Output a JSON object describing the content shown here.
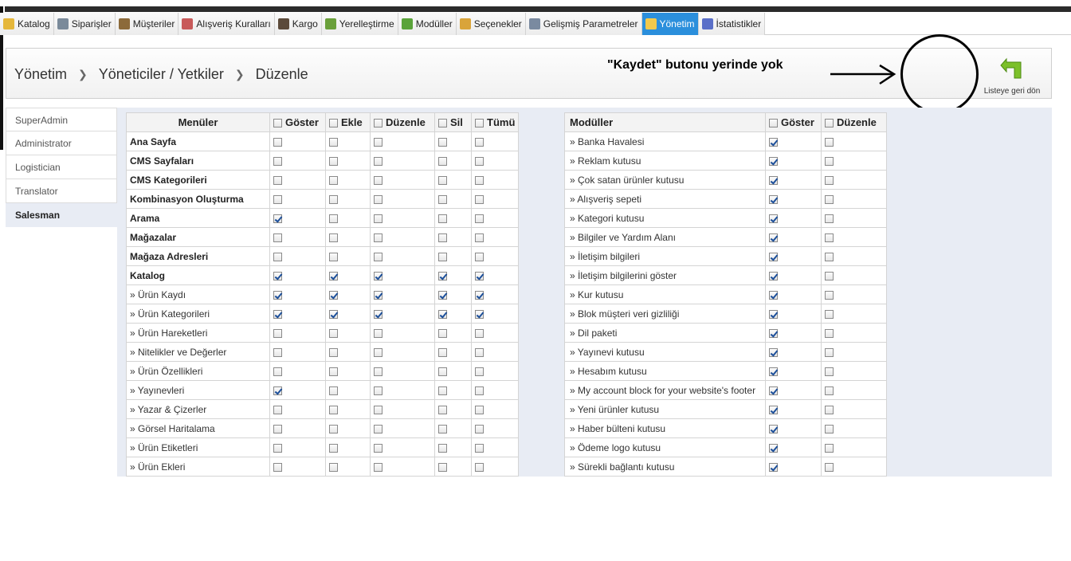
{
  "nav_tabs": [
    {
      "label": "Katalog",
      "icon": "folder-icon",
      "color": "#e5b73b"
    },
    {
      "label": "Siparişler",
      "icon": "cart-icon",
      "color": "#7a8a9a"
    },
    {
      "label": "Müşteriler",
      "icon": "user-icon",
      "color": "#8c6a3a"
    },
    {
      "label": "Alışveriş Kuralları",
      "icon": "rules-icon",
      "color": "#c85a5a"
    },
    {
      "label": "Kargo",
      "icon": "truck-icon",
      "color": "#5c4a3a"
    },
    {
      "label": "Yerelleştirme",
      "icon": "globe-icon",
      "color": "#6aa03a"
    },
    {
      "label": "Modüller",
      "icon": "puzzle-icon",
      "color": "#5aa33a"
    },
    {
      "label": "Seçenekler",
      "icon": "options-icon",
      "color": "#d9a43a"
    },
    {
      "label": "Gelişmiş Parametreler",
      "icon": "wrench-icon",
      "color": "#7a8aa0"
    },
    {
      "label": "Yönetim",
      "icon": "key-icon",
      "color": "#f2c94c",
      "active": true
    },
    {
      "label": "İstatistikler",
      "icon": "stats-icon",
      "color": "#5a6fc8"
    }
  ],
  "breadcrumb": [
    "Yönetim",
    "Yöneticiler / Yetkiler",
    "Düzenle"
  ],
  "annotation": "\"Kaydet\" butonu yerinde yok",
  "back_label": "Listeye geri dön",
  "profiles": [
    {
      "label": "SuperAdmin"
    },
    {
      "label": "Administrator"
    },
    {
      "label": "Logistician"
    },
    {
      "label": "Translator"
    },
    {
      "label": "Salesman",
      "active": true
    }
  ],
  "menus_table": {
    "headers": {
      "title": "Menüler",
      "show": "Göster",
      "add": "Ekle",
      "edit": "Düzenle",
      "delete": "Sil",
      "all": "Tümü"
    },
    "rows": [
      {
        "label": "Ana Sayfa",
        "bold": true,
        "v": [
          false,
          false,
          false,
          false,
          false
        ]
      },
      {
        "label": "CMS Sayfaları",
        "bold": true,
        "v": [
          false,
          false,
          false,
          false,
          false
        ]
      },
      {
        "label": "CMS Kategorileri",
        "bold": true,
        "v": [
          false,
          false,
          false,
          false,
          false
        ]
      },
      {
        "label": "Kombinasyon Oluşturma",
        "bold": true,
        "v": [
          false,
          false,
          false,
          false,
          false
        ]
      },
      {
        "label": "Arama",
        "bold": true,
        "v": [
          true,
          false,
          false,
          false,
          false
        ]
      },
      {
        "label": "Mağazalar",
        "bold": true,
        "v": [
          false,
          false,
          false,
          false,
          false
        ]
      },
      {
        "label": "Mağaza Adresleri",
        "bold": true,
        "v": [
          false,
          false,
          false,
          false,
          false
        ]
      },
      {
        "label": "Katalog",
        "bold": true,
        "v": [
          true,
          true,
          true,
          true,
          true
        ]
      },
      {
        "label": "» Ürün Kaydı",
        "bold": false,
        "v": [
          true,
          true,
          true,
          true,
          true
        ]
      },
      {
        "label": "» Ürün Kategorileri",
        "bold": false,
        "v": [
          true,
          true,
          true,
          true,
          true
        ]
      },
      {
        "label": "» Ürün Hareketleri",
        "bold": false,
        "v": [
          false,
          false,
          false,
          false,
          false
        ]
      },
      {
        "label": "» Nitelikler ve Değerler",
        "bold": false,
        "v": [
          false,
          false,
          false,
          false,
          false
        ]
      },
      {
        "label": "» Ürün Özellikleri",
        "bold": false,
        "v": [
          false,
          false,
          false,
          false,
          false
        ]
      },
      {
        "label": "» Yayınevleri",
        "bold": false,
        "v": [
          true,
          false,
          false,
          false,
          false
        ]
      },
      {
        "label": "» Yazar & Çizerler",
        "bold": false,
        "v": [
          false,
          false,
          false,
          false,
          false
        ]
      },
      {
        "label": "» Görsel Haritalama",
        "bold": false,
        "v": [
          false,
          false,
          false,
          false,
          false
        ]
      },
      {
        "label": "» Ürün Etiketleri",
        "bold": false,
        "v": [
          false,
          false,
          false,
          false,
          false
        ]
      },
      {
        "label": "» Ürün Ekleri",
        "bold": false,
        "v": [
          false,
          false,
          false,
          false,
          false
        ]
      }
    ]
  },
  "modules_table": {
    "headers": {
      "title": "Modüller",
      "show": "Göster",
      "edit": "Düzenle"
    },
    "rows": [
      {
        "label": "» Banka Havalesi",
        "v": [
          true,
          false
        ]
      },
      {
        "label": "» Reklam kutusu",
        "v": [
          true,
          false
        ]
      },
      {
        "label": "» Çok satan ürünler kutusu",
        "v": [
          true,
          false
        ]
      },
      {
        "label": "» Alışveriş sepeti",
        "v": [
          true,
          false
        ]
      },
      {
        "label": "» Kategori kutusu",
        "v": [
          true,
          false
        ]
      },
      {
        "label": "» Bilgiler ve Yardım Alanı",
        "v": [
          true,
          false
        ]
      },
      {
        "label": "» İletişim bilgileri",
        "v": [
          true,
          false
        ]
      },
      {
        "label": "» İletişim bilgilerini göster",
        "v": [
          true,
          false
        ]
      },
      {
        "label": "» Kur kutusu",
        "v": [
          true,
          false
        ]
      },
      {
        "label": "» Blok müşteri veri gizliliği",
        "v": [
          true,
          false
        ]
      },
      {
        "label": "» Dil paketi",
        "v": [
          true,
          false
        ]
      },
      {
        "label": "» Yayınevi kutusu",
        "v": [
          true,
          false
        ]
      },
      {
        "label": "» Hesabım kutusu",
        "v": [
          true,
          false
        ]
      },
      {
        "label": "» My account block for your website's footer",
        "v": [
          true,
          false
        ]
      },
      {
        "label": "» Yeni ürünler kutusu",
        "v": [
          true,
          false
        ]
      },
      {
        "label": "» Haber bülteni kutusu",
        "v": [
          true,
          false
        ]
      },
      {
        "label": "» Ödeme logo kutusu",
        "v": [
          true,
          false
        ]
      },
      {
        "label": "» Sürekli bağlantı kutusu",
        "v": [
          true,
          false
        ]
      }
    ]
  }
}
